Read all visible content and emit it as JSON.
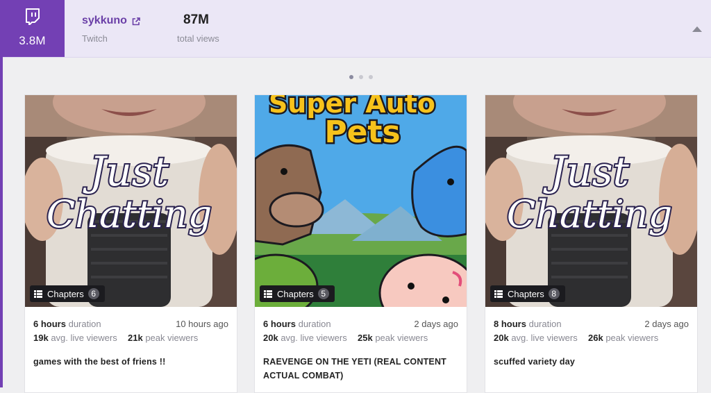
{
  "header": {
    "platform_icon": "twitch-icon",
    "followers": "3.8M",
    "channel_name": "sykkuno",
    "platform": "Twitch",
    "total_views_value": "87M",
    "total_views_label": "total views",
    "accent_color": "#7340b4"
  },
  "carousel": {
    "page_count": 3,
    "active_page": 1
  },
  "cards": [
    {
      "thumbnail_text": [
        "Just",
        "Chatting"
      ],
      "chapters_label": "Chapters",
      "chapters_count": "6",
      "duration_value": "6 hours",
      "duration_label": "duration",
      "time_ago": "10 hours ago",
      "avg_value": "19k",
      "avg_label": "avg. live viewers",
      "peak_value": "21k",
      "peak_label": "peak viewers",
      "title_line1": "games with the best of friens !!",
      "title_line2": ""
    },
    {
      "thumbnail_text": [
        "Super Auto",
        "Pets"
      ],
      "chapters_label": "Chapters",
      "chapters_count": "5",
      "duration_value": "6 hours",
      "duration_label": "duration",
      "time_ago": "2 days ago",
      "avg_value": "20k",
      "avg_label": "avg. live viewers",
      "peak_value": "25k",
      "peak_label": "peak viewers",
      "title_line1": "RAEVENGE ON THE YETI (REAL CONTENT",
      "title_line2": "ACTUAL COMBAT)"
    },
    {
      "thumbnail_text": [
        "Just",
        "Chatting"
      ],
      "chapters_label": "Chapters",
      "chapters_count": "8",
      "duration_value": "8 hours",
      "duration_label": "duration",
      "time_ago": "2 days ago",
      "avg_value": "20k",
      "avg_label": "avg. live viewers",
      "peak_value": "26k",
      "peak_label": "peak viewers",
      "title_line1": "scuffed variety day",
      "title_line2": ""
    }
  ]
}
